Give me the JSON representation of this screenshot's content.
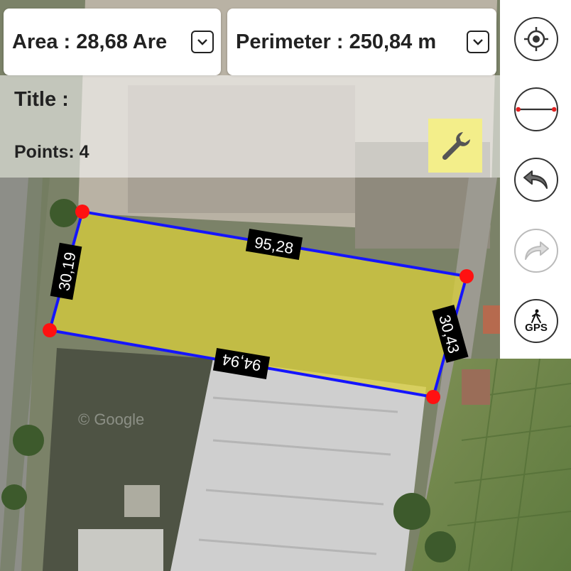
{
  "summary": {
    "area": "Area : 28,68 Are",
    "perimeter": "Perimeter : 250,84 m"
  },
  "info": {
    "title_label": "Title :",
    "points_label": "Points: 4"
  },
  "polygon": {
    "fill_color": "#d9cf3a",
    "stroke_color": "#1515ff",
    "vertex_color": "#ff1111",
    "edges": [
      "95,28",
      "30,43",
      "94,94",
      "30,19"
    ]
  },
  "map": {
    "watermark": "© Google"
  },
  "toolbar": {
    "gps_label": "GPS",
    "buttons": [
      "my-location",
      "measure-line",
      "undo",
      "redo",
      "gps-walk"
    ]
  }
}
